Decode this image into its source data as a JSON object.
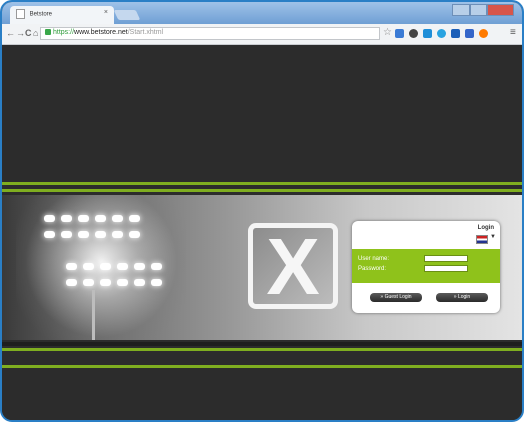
{
  "browser": {
    "tab_title": "Betstore",
    "tab_close": "×",
    "nav": {
      "back": "←",
      "forward": "→",
      "reload": "C",
      "home": "⌂"
    },
    "address": {
      "scheme": "https://",
      "host": "www.betstore.net",
      "path": "/Start.xhtml"
    },
    "bookmark_star": "☆",
    "menu_icon": "≡",
    "extension_colors": [
      "#3a7bd5",
      "#444444",
      "#1f8fd8",
      "#2aa3e0",
      "#1c5fb8",
      "#3566c9",
      "#ff7a00"
    ]
  },
  "login": {
    "title": "Login",
    "language": "English",
    "username_label": "User name:",
    "password_label": "Password:",
    "guest_login_label": "» Guest Login",
    "login_label": "» Login"
  },
  "colors": {
    "accent_green": "#8fc21b",
    "page_dark": "#2c2c2c",
    "window_border": "#2a7fc6"
  }
}
